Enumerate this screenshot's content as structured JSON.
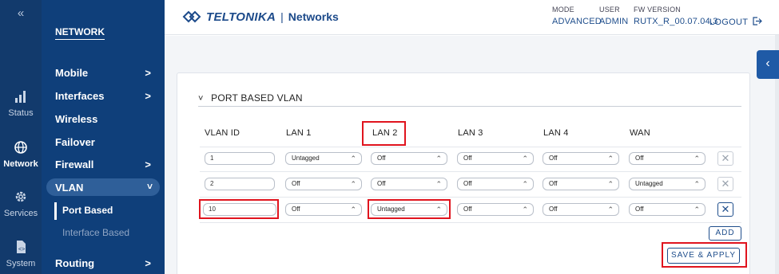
{
  "rail": {
    "collapse_glyph": "«",
    "items": [
      {
        "label": "Status",
        "icon": "bar-chart-icon"
      },
      {
        "label": "Network",
        "icon": "globe-icon"
      },
      {
        "label": "Services",
        "icon": "gear-icon"
      },
      {
        "label": "System",
        "icon": "file-code-icon"
      }
    ]
  },
  "nav": {
    "heading": "NETWORK",
    "items": [
      {
        "label": "Mobile",
        "chevron": ">"
      },
      {
        "label": "Interfaces",
        "chevron": ">"
      },
      {
        "label": "Wireless",
        "chevron": ""
      },
      {
        "label": "Failover",
        "chevron": ""
      },
      {
        "label": "Firewall",
        "chevron": ">"
      },
      {
        "label": "Routing",
        "chevron": ">"
      }
    ],
    "active": {
      "label": "VLAN",
      "chevron": "˅"
    },
    "subitems": [
      {
        "label": "Port Based"
      },
      {
        "label": "Interface Based"
      }
    ]
  },
  "header": {
    "brand": "TELTONIKA",
    "separator": "|",
    "product": "Networks",
    "mode": {
      "label": "MODE",
      "value": "ADVANCED"
    },
    "user": {
      "label": "USER",
      "value": "ADMIN"
    },
    "fw": {
      "label": "FW VERSION",
      "value": "RUTX_R_00.07.04.3"
    },
    "logout": "LOGOUT"
  },
  "section": {
    "toggle": "˅",
    "title": "PORT BASED VLAN"
  },
  "table": {
    "columns": [
      "VLAN ID",
      "LAN 1",
      "LAN 2",
      "LAN 3",
      "LAN 4",
      "WAN"
    ],
    "rows": [
      {
        "vlan_id": "1",
        "lan1": "Untagged",
        "lan2": "Off",
        "lan3": "Off",
        "lan4": "Off",
        "wan": "Off"
      },
      {
        "vlan_id": "2",
        "lan1": "Off",
        "lan2": "Off",
        "lan3": "Off",
        "lan4": "Off",
        "wan": "Untagged"
      },
      {
        "vlan_id": "10",
        "lan1": "Off",
        "lan2": "Untagged",
        "lan3": "Off",
        "lan4": "Off",
        "wan": "Off"
      }
    ],
    "delete_glyph": "✕"
  },
  "buttons": {
    "add": "ADD",
    "save_apply": "SAVE & APPLY"
  },
  "side_tab_glyph": "‹",
  "colors": {
    "rail_bg": "#123a6c",
    "nav_bg": "#0f3f7a",
    "accent": "#1f4e8c",
    "highlight": "#e0141e"
  }
}
